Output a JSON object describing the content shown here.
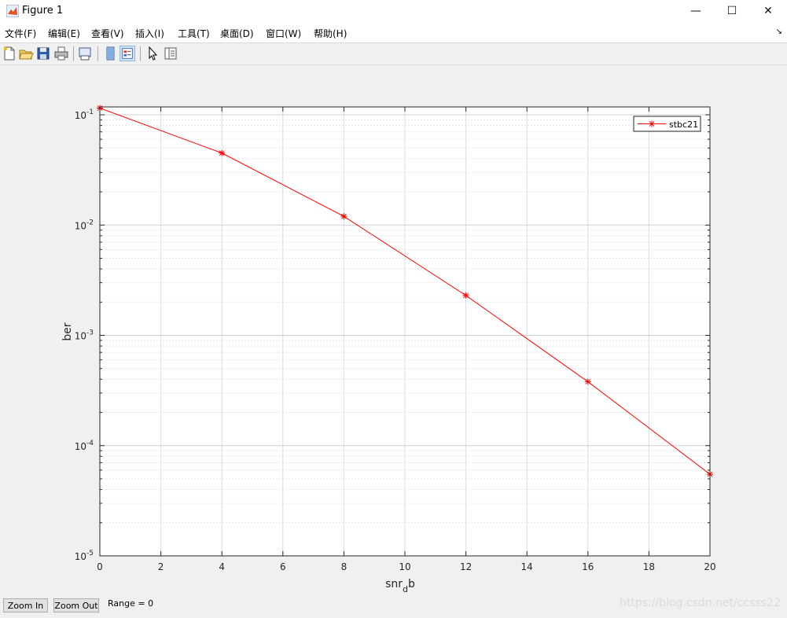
{
  "window": {
    "title": "Figure 1",
    "controls": {
      "minimize": "—",
      "maximize": "☐",
      "close": "✕"
    }
  },
  "menu": [
    {
      "label": "文件(F)"
    },
    {
      "label": "编辑(E)"
    },
    {
      "label": "查看(V)"
    },
    {
      "label": "插入(I)"
    },
    {
      "label": "工具(T)"
    },
    {
      "label": "桌面(D)"
    },
    {
      "label": "窗口(W)"
    },
    {
      "label": "帮助(H)"
    }
  ],
  "toolbar": {
    "icons": [
      "new-figure-icon",
      "open-file-icon",
      "save-icon",
      "print-icon",
      "print-preview-icon",
      "hide-plot-tools-icon",
      "show-plot-tools-icon",
      "edit-plot-icon",
      "plot-browser-icon"
    ]
  },
  "chart_data": {
    "type": "line",
    "yscale": "log",
    "x": [
      0,
      4,
      8,
      12,
      16,
      20
    ],
    "series": [
      {
        "name": "stbc21",
        "color": "#ff0000",
        "marker": "*",
        "values": [
          0.115,
          0.045,
          0.012,
          0.0023,
          0.00038,
          5.5e-05
        ]
      }
    ],
    "xlim": [
      0,
      20
    ],
    "ylim": [
      1e-05,
      0.12
    ],
    "xticks": [
      "0",
      "2",
      "4",
      "6",
      "8",
      "10",
      "12",
      "14",
      "16",
      "18",
      "20"
    ],
    "yticks": [
      {
        "base": "10",
        "exp": "-5"
      },
      {
        "base": "10",
        "exp": "-4"
      },
      {
        "base": "10",
        "exp": "-3"
      },
      {
        "base": "10",
        "exp": "-2"
      },
      {
        "base": "10",
        "exp": "-1"
      }
    ],
    "xlabel": {
      "main": "snr",
      "sub": "d",
      "rest": "b"
    },
    "ylabel": "ber",
    "grid": true,
    "legend_position": "top-right"
  },
  "bottom": {
    "zoom_in": "Zoom In",
    "zoom_out": "Zoom Out",
    "range_text": "Range = 0"
  },
  "watermark": "https://blog.csdn.net/ccsss22"
}
